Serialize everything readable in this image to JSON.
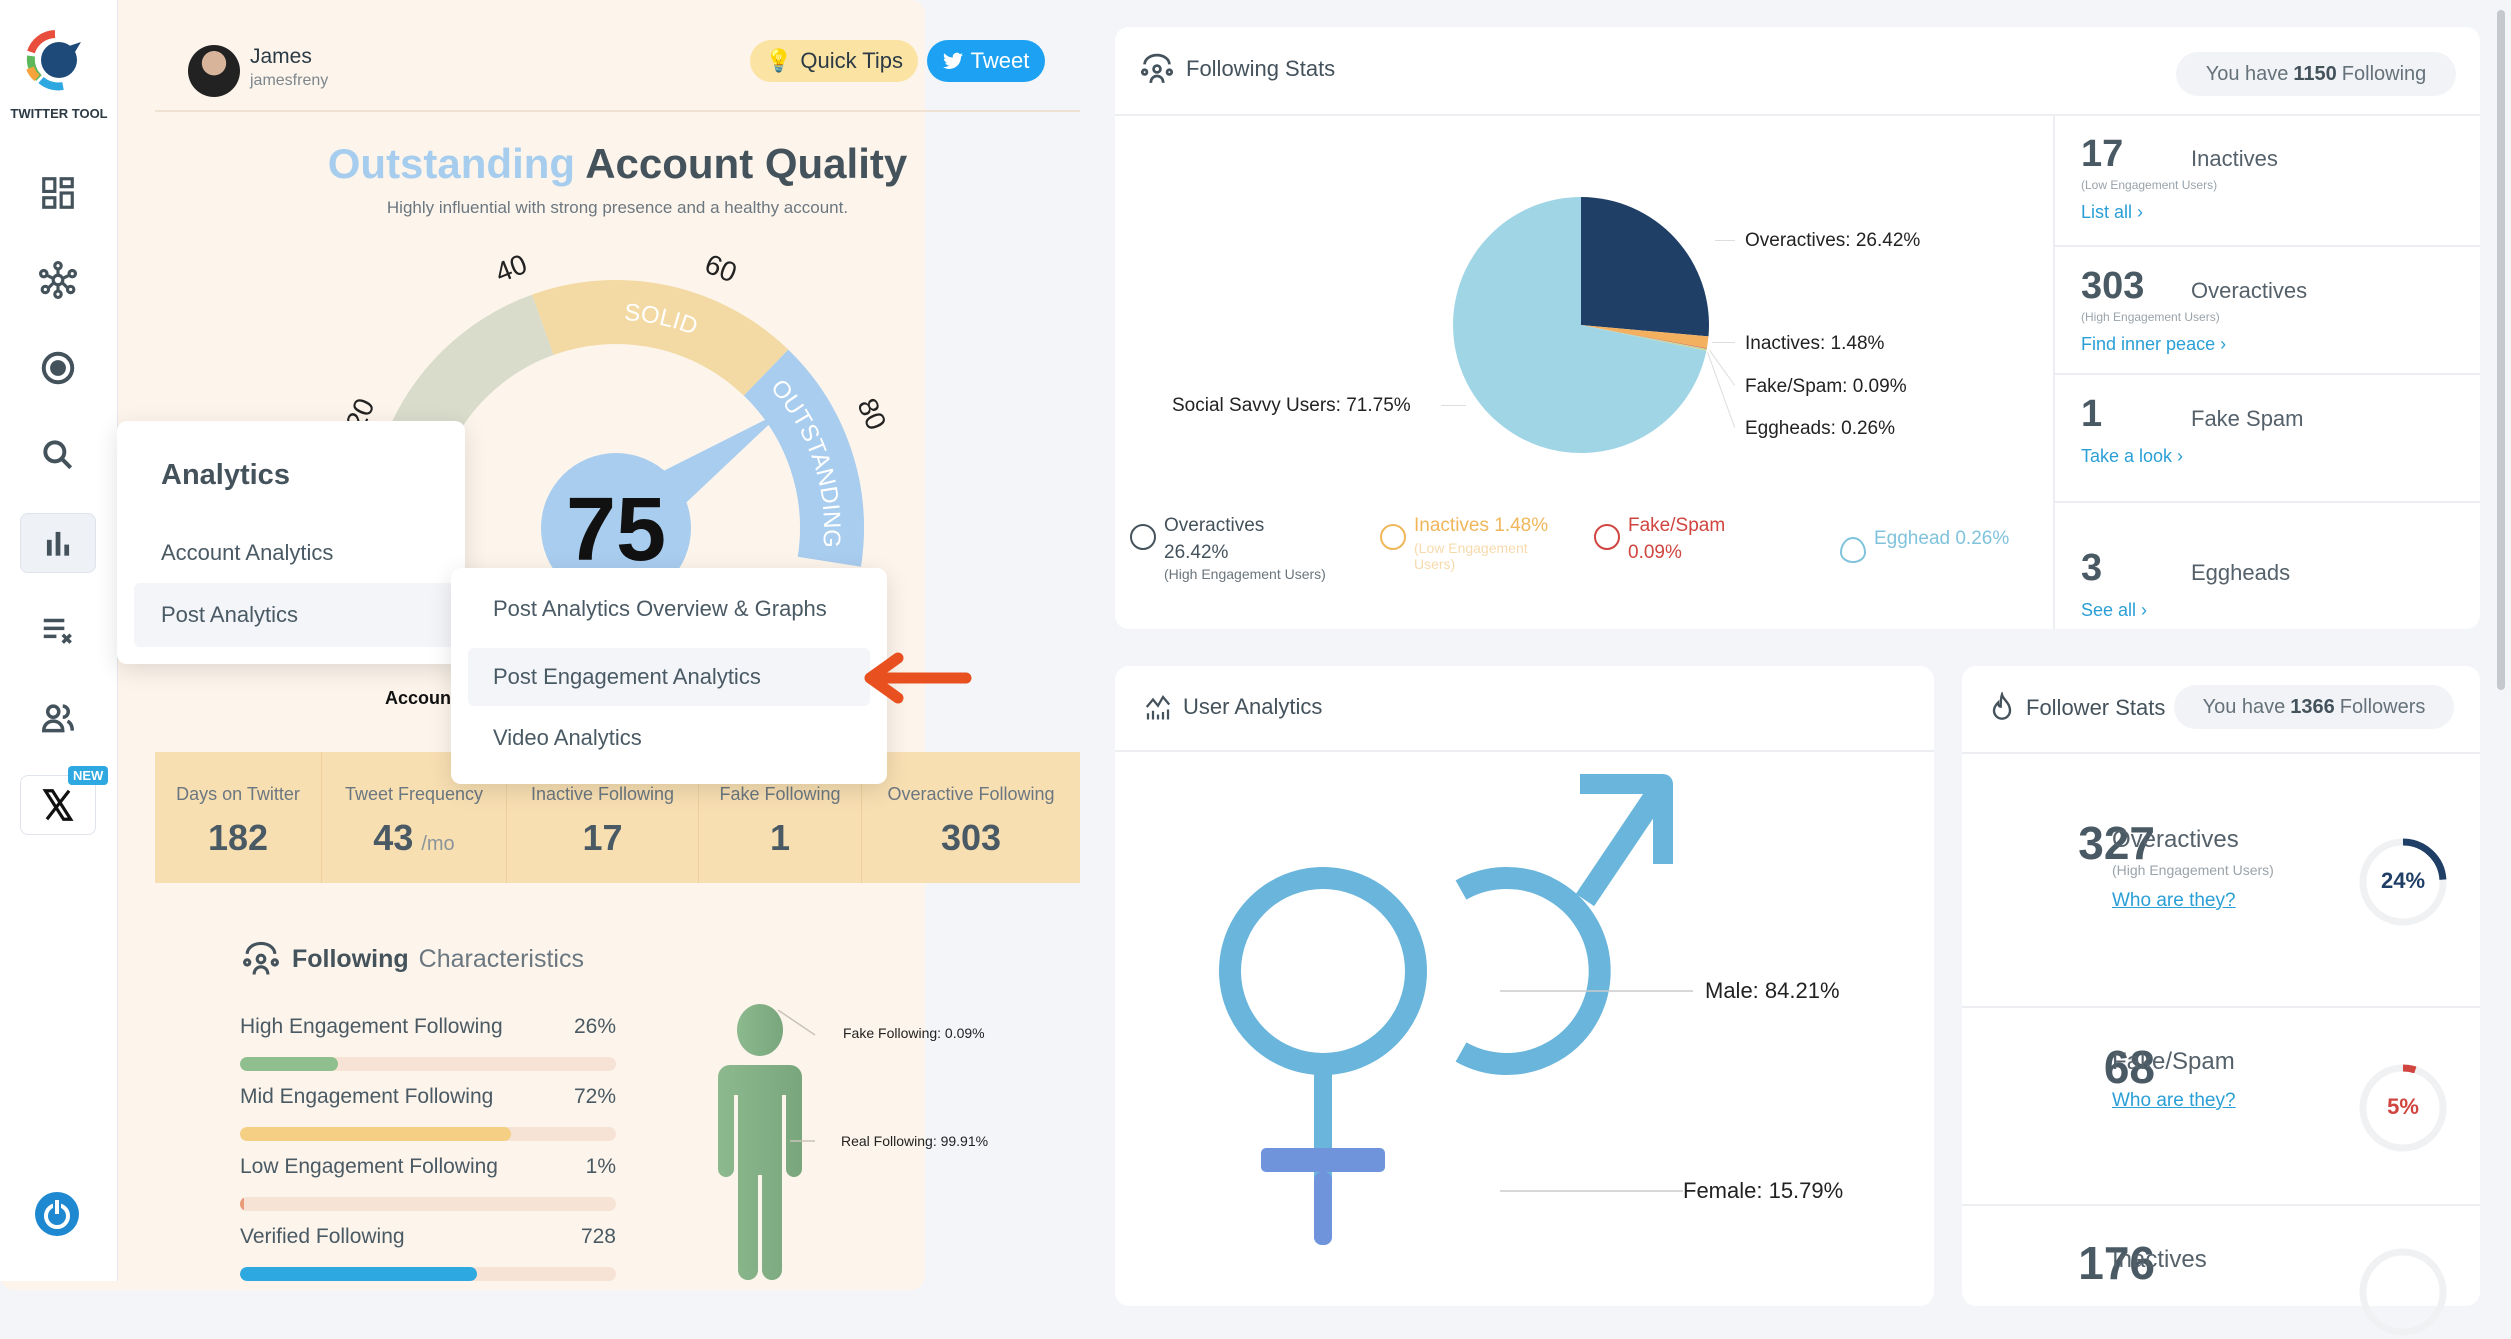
{
  "sidebar": {
    "brand": "TWITTER TOOL",
    "new_badge": "NEW",
    "items": [
      {
        "icon": "dashboard-icon"
      },
      {
        "icon": "network-icon"
      },
      {
        "icon": "target-icon"
      },
      {
        "icon": "search-icon"
      },
      {
        "icon": "analytics-bar-chart-icon",
        "active": true
      },
      {
        "icon": "list-remove-icon"
      },
      {
        "icon": "users-icon"
      },
      {
        "icon": "x-logo-icon"
      }
    ],
    "power_icon": "power-icon"
  },
  "profile": {
    "name": "James",
    "handle": "jamesfreny"
  },
  "header_buttons": {
    "quick_tips": "Quick Tips",
    "tweet": "Tweet"
  },
  "quality": {
    "level": "Outstanding",
    "title": "Account Quality",
    "subtitle": "Highly influential with strong presence and a healthy account.",
    "score": "75",
    "score_value": 75,
    "ticks": [
      "20",
      "40",
      "60",
      "80"
    ],
    "segments": [
      {
        "label": "",
        "from": 5,
        "to": 41,
        "color": "#d9dccb"
      },
      {
        "label": "SOLID",
        "from": 41,
        "to": 70,
        "color": "#f3d9a3"
      },
      {
        "label": "OUTSTANDING",
        "from": 70,
        "to": 95,
        "color": "#a9cdef"
      }
    ],
    "below_label": "Account"
  },
  "stats": [
    {
      "label": "Days on Twitter",
      "value": "182",
      "unit": ""
    },
    {
      "label": "Tweet Frequency",
      "value": "43",
      "unit": "/mo"
    },
    {
      "label": "Inactive Following",
      "value": "17",
      "unit": ""
    },
    {
      "label": "Fake Following",
      "value": "1",
      "unit": ""
    },
    {
      "label": "Overactive Following",
      "value": "303",
      "unit": ""
    }
  ],
  "characteristics": {
    "title_bold": "Following",
    "title_rest": "Characteristics",
    "bars": [
      {
        "label": "High Engagement Following",
        "value": "26%",
        "fill": 26,
        "color": "#8fbf8f"
      },
      {
        "label": "Mid Engagement Following",
        "value": "72%",
        "fill": 72,
        "color": "#f5cf83"
      },
      {
        "label": "Low Engagement Following",
        "value": "1%",
        "fill": 1,
        "color": "#e99a78"
      },
      {
        "label": "Verified Following",
        "value": "728",
        "fill": 63,
        "color": "#2ea8e0"
      }
    ],
    "fake_label": "Fake Following: 0.09%",
    "real_label": "Real Following: 99.91%"
  },
  "menu": {
    "title": "Analytics",
    "items": [
      "Account Analytics",
      "Post Analytics"
    ],
    "submenu": [
      "Post Analytics Overview & Graphs",
      "Post Engagement Analytics",
      "Video Analytics"
    ]
  },
  "following_stats": {
    "title": "Following Stats",
    "pill_pre": "You have ",
    "pill_count": "1150",
    "pill_post": " Following",
    "chart_data": {
      "type": "pie",
      "slices": [
        {
          "name": "Overactives",
          "value": 26.42,
          "color": "#203f66",
          "label": "Overactives: 26.42%"
        },
        {
          "name": "Inactives",
          "value": 1.48,
          "color": "#f3b160",
          "label": "Inactives: 1.48%"
        },
        {
          "name": "Fake/Spam",
          "value": 0.09,
          "color": "#d9534f",
          "label": "Fake/Spam: 0.09%"
        },
        {
          "name": "Eggheads",
          "value": 0.26,
          "color": "#c6d6a0",
          "label": "Eggheads: 0.26%"
        },
        {
          "name": "Social Savvy Users",
          "value": 71.75,
          "color": "#a0d5e6",
          "label": "Social Savvy Users: 71.75%"
        }
      ]
    },
    "legend": [
      {
        "label": "Overactives",
        "value": "26.42%",
        "sub": "(High Engagement Users)",
        "color": "#44525c"
      },
      {
        "label": "Inactives 1.48%",
        "value": "",
        "sub": "(Low Engagement Users)",
        "color": "#f0b65a"
      },
      {
        "label": "Fake/Spam",
        "value": "0.09%",
        "sub": "",
        "color": "#d0453f"
      },
      {
        "label": "Egghead 0.26%",
        "value": "",
        "sub": "",
        "color": "#7fc3dc"
      }
    ],
    "rows": [
      {
        "count": "17",
        "name": "Inactives",
        "sub": "(Low Engagement Users)",
        "link": "List all ›"
      },
      {
        "count": "303",
        "name": "Overactives",
        "sub": "(High Engagement Users)",
        "link": "Find inner peace ›"
      },
      {
        "count": "1",
        "name": "Fake Spam",
        "sub": "",
        "link": "Take a look ›"
      },
      {
        "count": "3",
        "name": "Eggheads",
        "sub": "",
        "link": "See all ›"
      }
    ]
  },
  "user_analytics": {
    "title": "User Analytics",
    "male": "Male: 84.21%",
    "female": "Female: 15.79%"
  },
  "follower_stats": {
    "title": "Follower Stats",
    "pill_pre": "You have ",
    "pill_count": "1366",
    "pill_post": " Followers",
    "rows": [
      {
        "count": "327",
        "name": "Overactives",
        "sub": "(High Engagement Users)",
        "link": "Who are they?",
        "pct": "24%",
        "value": 24,
        "color": "#203f66"
      },
      {
        "count": "68",
        "name": "Fake/Spam",
        "sub": "",
        "link": "Who are they?",
        "pct": "5%",
        "value": 5,
        "color": "#d0453f"
      },
      {
        "count": "176",
        "name": "Inactives",
        "sub": "",
        "link": "",
        "pct": "",
        "value": 0,
        "color": "#a0d5e6"
      }
    ]
  }
}
